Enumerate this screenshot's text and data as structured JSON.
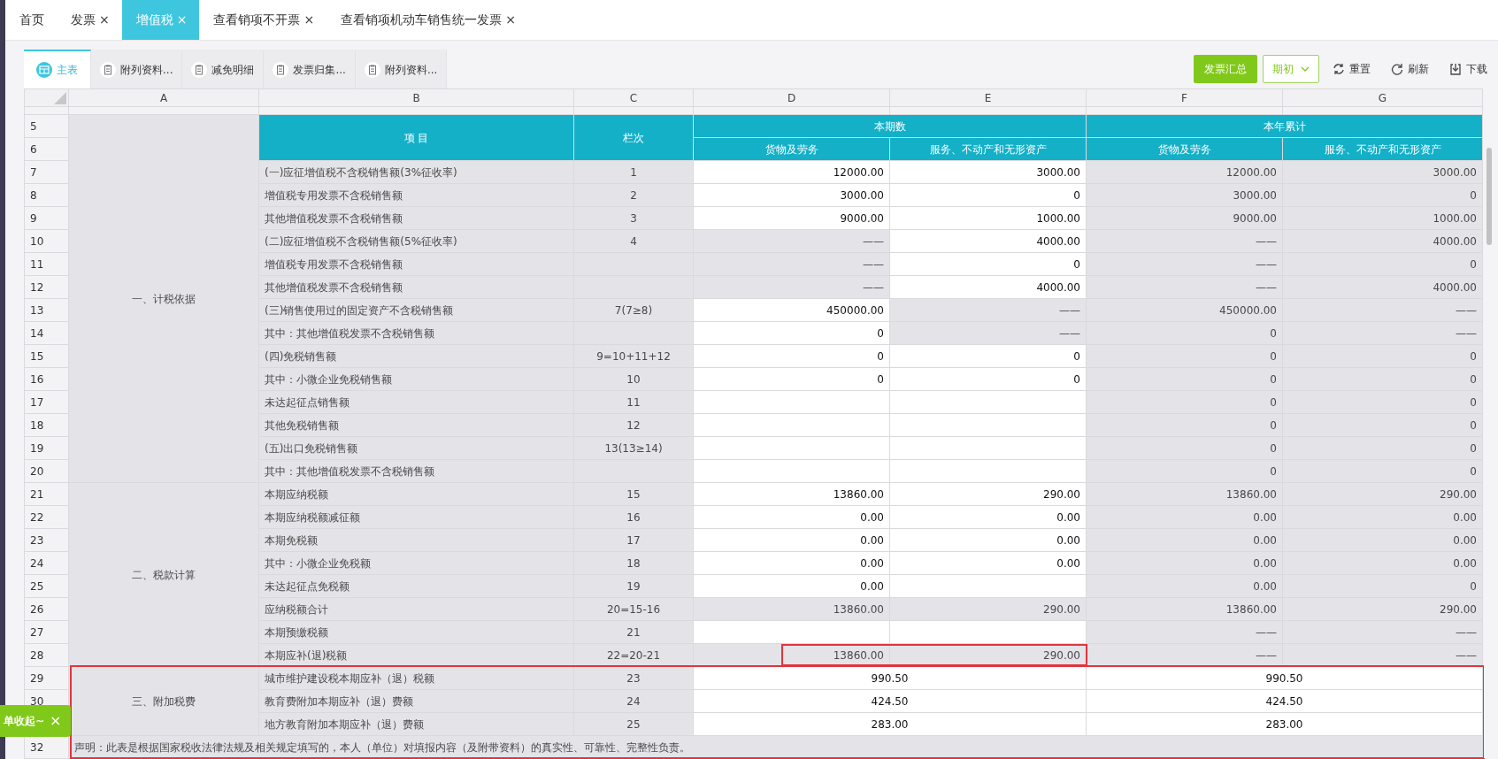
{
  "tabs": [
    {
      "label": "首页",
      "closable": false,
      "selected": false
    },
    {
      "label": "发票",
      "closable": true,
      "selected": false
    },
    {
      "label": "增值税",
      "closable": true,
      "selected": true
    },
    {
      "label": "查看销项不开票",
      "closable": true,
      "selected": false
    },
    {
      "label": "查看销项机动车销售统一发票",
      "closable": true,
      "selected": false
    }
  ],
  "close_mark": "×",
  "sheet_tabs": [
    {
      "label": "主表",
      "kind": "main",
      "selected": true
    },
    {
      "label": "附列资料...",
      "kind": "attachment",
      "selected": false
    },
    {
      "label": "减免明细",
      "kind": "attachment",
      "selected": false
    },
    {
      "label": "发票归集...",
      "kind": "attachment",
      "selected": false
    },
    {
      "label": "附列资料...",
      "kind": "attachment",
      "selected": false
    }
  ],
  "toolbar": {
    "primary_button": "发票汇总",
    "period_dropdown": "期初",
    "actions": [
      {
        "label": "重置",
        "kind": "reset"
      },
      {
        "label": "刷新",
        "kind": "refresh"
      },
      {
        "label": "下载",
        "kind": "download"
      }
    ]
  },
  "column_letters": [
    "A",
    "B",
    "C",
    "D",
    "E",
    "F",
    "G"
  ],
  "header": {
    "row_numbers": [
      "5",
      "6"
    ],
    "item": "项 目",
    "line_no": "栏次",
    "groups": [
      {
        "label": "本期数",
        "columns": [
          "货物及劳务",
          "服务、不动产和无形资产"
        ]
      },
      {
        "label": "本年累计",
        "columns": [
          "货物及劳务",
          "服务、不动产和无形资产"
        ]
      }
    ]
  },
  "sections": [
    {
      "label": "一、计税依据",
      "red_frame": false,
      "rows": [
        {
          "number": "7",
          "item": "(一)应征增值税不含税销售额(3%征收率)",
          "line": "1",
          "kind": "split",
          "red_frame": false,
          "values": [
            {
              "text": "12000.00",
              "editable": true
            },
            {
              "text": "3000.00",
              "editable": true
            },
            {
              "text": "12000.00",
              "editable": false
            },
            {
              "text": "3000.00",
              "editable": false
            }
          ]
        },
        {
          "number": "8",
          "item": "增值税专用发票不含税销售额",
          "line": "2",
          "kind": "split",
          "red_frame": false,
          "values": [
            {
              "text": "3000.00",
              "editable": true
            },
            {
              "text": "0",
              "editable": true
            },
            {
              "text": "3000.00",
              "editable": false
            },
            {
              "text": "0",
              "editable": false
            }
          ]
        },
        {
          "number": "9",
          "item": "其他增值税发票不含税销售额",
          "line": "3",
          "kind": "split",
          "red_frame": false,
          "values": [
            {
              "text": "9000.00",
              "editable": true
            },
            {
              "text": "1000.00",
              "editable": true
            },
            {
              "text": "9000.00",
              "editable": false
            },
            {
              "text": "1000.00",
              "editable": false
            }
          ]
        },
        {
          "number": "10",
          "item": "(二)应征增值税不含税销售额(5%征收率)",
          "line": "4",
          "kind": "split",
          "red_frame": false,
          "values": [
            {
              "text": "——",
              "editable": false
            },
            {
              "text": "4000.00",
              "editable": true
            },
            {
              "text": "——",
              "editable": false
            },
            {
              "text": "4000.00",
              "editable": false
            }
          ]
        },
        {
          "number": "11",
          "item": "增值税专用发票不含税销售额",
          "kind": "split",
          "red_frame": false,
          "values": [
            {
              "text": "——",
              "editable": false
            },
            {
              "text": "0",
              "editable": true
            },
            {
              "text": "——",
              "editable": false
            },
            {
              "text": "0",
              "editable": false
            }
          ]
        },
        {
          "number": "12",
          "item": "其他增值税发票不含税销售额",
          "kind": "split",
          "red_frame": false,
          "values": [
            {
              "text": "——",
              "editable": false
            },
            {
              "text": "4000.00",
              "editable": true
            },
            {
              "text": "——",
              "editable": false
            },
            {
              "text": "4000.00",
              "editable": false
            }
          ]
        },
        {
          "number": "13",
          "item": "(三)销售使用过的固定资产不含税销售额",
          "line": "7(7≥8)",
          "kind": "split",
          "red_frame": false,
          "values": [
            {
              "text": "450000.00",
              "editable": true
            },
            {
              "text": "——",
              "editable": false
            },
            {
              "text": "450000.00",
              "editable": false
            },
            {
              "text": "——",
              "editable": false
            }
          ]
        },
        {
          "number": "14",
          "item": "其中：其他增值税发票不含税销售额",
          "kind": "split",
          "red_frame": false,
          "values": [
            {
              "text": "0",
              "editable": true
            },
            {
              "text": "——",
              "editable": false
            },
            {
              "text": "0",
              "editable": false
            },
            {
              "text": "——",
              "editable": false
            }
          ]
        },
        {
          "number": "15",
          "item": "(四)免税销售额",
          "line": "9=10+11+12",
          "kind": "split",
          "red_frame": false,
          "values": [
            {
              "text": "0",
              "editable": true
            },
            {
              "text": "0",
              "editable": true
            },
            {
              "text": "0",
              "editable": false
            },
            {
              "text": "0",
              "editable": false
            }
          ]
        },
        {
          "number": "16",
          "item": "其中：小微企业免税销售额",
          "line": "10",
          "kind": "split",
          "red_frame": false,
          "values": [
            {
              "text": "0",
              "editable": true
            },
            {
              "text": "0",
              "editable": true
            },
            {
              "text": "0",
              "editable": false
            },
            {
              "text": "0",
              "editable": false
            }
          ]
        },
        {
          "number": "17",
          "item": "未达起征点销售额",
          "line": "11",
          "kind": "split",
          "red_frame": false,
          "values": [
            {
              "editable": true
            },
            {
              "editable": true
            },
            {
              "text": "0",
              "editable": false
            },
            {
              "text": "0",
              "editable": false
            }
          ]
        },
        {
          "number": "18",
          "item": "其他免税销售额",
          "line": "12",
          "kind": "split",
          "red_frame": false,
          "values": [
            {
              "editable": true
            },
            {
              "editable": true
            },
            {
              "text": "0",
              "editable": false
            },
            {
              "text": "0",
              "editable": false
            }
          ]
        },
        {
          "number": "19",
          "item": "(五)出口免税销售额",
          "line": "13(13≥14)",
          "kind": "split",
          "red_frame": false,
          "values": [
            {
              "editable": true
            },
            {
              "editable": true
            },
            {
              "text": "0",
              "editable": false
            },
            {
              "text": "0",
              "editable": false
            }
          ]
        },
        {
          "number": "20",
          "item": "其中：其他增值税发票不含税销售额",
          "kind": "split",
          "red_frame": false,
          "values": [
            {
              "editable": true
            },
            {
              "editable": true
            },
            {
              "text": "0",
              "editable": false
            },
            {
              "text": "0",
              "editable": false
            }
          ]
        }
      ]
    },
    {
      "label": "二、税款计算",
      "red_frame": false,
      "rows": [
        {
          "number": "21",
          "item": "本期应纳税额",
          "line": "15",
          "kind": "split",
          "red_frame": false,
          "values": [
            {
              "text": "13860.00",
              "editable": true
            },
            {
              "text": "290.00",
              "editable": true
            },
            {
              "text": "13860.00",
              "editable": false
            },
            {
              "text": "290.00",
              "editable": false
            }
          ]
        },
        {
          "number": "22",
          "item": "本期应纳税额减征额",
          "line": "16",
          "kind": "split",
          "red_frame": false,
          "values": [
            {
              "text": "0.00",
              "editable": true
            },
            {
              "text": "0.00",
              "editable": true
            },
            {
              "text": "0.00",
              "editable": false
            },
            {
              "text": "0.00",
              "editable": false
            }
          ]
        },
        {
          "number": "23",
          "item": "本期免税额",
          "line": "17",
          "kind": "split",
          "red_frame": false,
          "values": [
            {
              "text": "0.00",
              "editable": true
            },
            {
              "text": "0.00",
              "editable": true
            },
            {
              "text": "0.00",
              "editable": false
            },
            {
              "text": "0.00",
              "editable": false
            }
          ]
        },
        {
          "number": "24",
          "item": "其中：小微企业免税额",
          "line": "18",
          "kind": "split",
          "red_frame": false,
          "values": [
            {
              "text": "0.00",
              "editable": true
            },
            {
              "text": "0.00",
              "editable": true
            },
            {
              "text": "0.00",
              "editable": false
            },
            {
              "text": "0.00",
              "editable": false
            }
          ]
        },
        {
          "number": "25",
          "item": "未达起征点免税额",
          "line": "19",
          "kind": "split",
          "red_frame": false,
          "values": [
            {
              "text": "0.00",
              "editable": true
            },
            {
              "editable": true
            },
            {
              "text": "0.00",
              "editable": false
            },
            {
              "text": "0",
              "editable": false
            }
          ]
        },
        {
          "number": "26",
          "item": "应纳税额合计",
          "line": "20=15-16",
          "kind": "split",
          "red_frame": false,
          "values": [
            {
              "text": "13860.00",
              "editable": false
            },
            {
              "text": "290.00",
              "editable": false
            },
            {
              "text": "13860.00",
              "editable": false
            },
            {
              "text": "290.00",
              "editable": false
            }
          ]
        },
        {
          "number": "27",
          "item": "本期预缴税额",
          "line": "21",
          "kind": "split",
          "red_frame": false,
          "values": [
            {
              "editable": true
            },
            {
              "editable": true
            },
            {
              "text": "——",
              "editable": false
            },
            {
              "text": "——",
              "editable": false
            }
          ]
        },
        {
          "number": "28",
          "item": "本期应补(退)税额",
          "line": "22=20-21",
          "kind": "split",
          "red_frame": true,
          "values": [
            {
              "text": "13860.00",
              "editable": false
            },
            {
              "text": "290.00",
              "editable": false
            },
            {
              "text": "——",
              "editable": false
            },
            {
              "text": "——",
              "editable": false
            }
          ]
        }
      ]
    },
    {
      "label": "三、附加税费",
      "red_frame": true,
      "rows": [
        {
          "number": "29",
          "item": "城市维护建设税本期应补（退）税额",
          "line": "23",
          "kind": "merged",
          "red_frame": false,
          "values": [
            {
              "text": "990.50",
              "editable": true
            },
            {
              "text": "990.50",
              "editable": true
            }
          ]
        },
        {
          "number": "30",
          "item": "教育费附加本期应补（退）费额",
          "line": "24",
          "kind": "merged",
          "red_frame": false,
          "values": [
            {
              "text": "424.50",
              "editable": true
            },
            {
              "text": "424.50",
              "editable": true
            }
          ]
        },
        {
          "item": "地方教育附加本期应补（退）费额",
          "line": "25",
          "kind": "merged",
          "red_frame": false,
          "values": [
            {
              "text": "283.00",
              "editable": true
            },
            {
              "text": "283.00",
              "editable": true
            }
          ]
        }
      ]
    }
  ],
  "statement": {
    "number": "32",
    "text": "声明：此表是根据国家税收法律法规及相关规定填写的，本人（单位）对填报内容（及附带资料）的真实性、可靠性、完整性负责。"
  },
  "toast": {
    "text": "单收起~",
    "close": "×"
  }
}
